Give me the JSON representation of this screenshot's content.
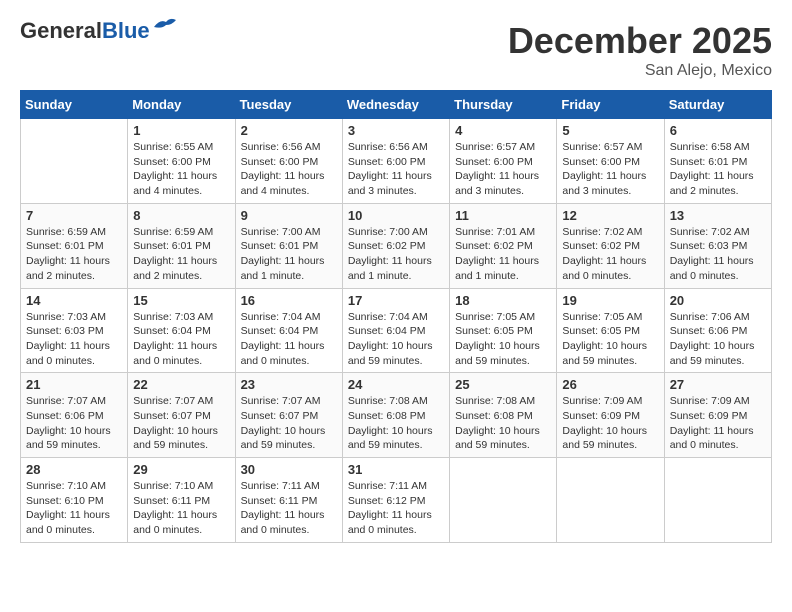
{
  "header": {
    "logo_general": "General",
    "logo_blue": "Blue",
    "month": "December 2025",
    "location": "San Alejo, Mexico"
  },
  "weekdays": [
    "Sunday",
    "Monday",
    "Tuesday",
    "Wednesday",
    "Thursday",
    "Friday",
    "Saturday"
  ],
  "weeks": [
    [
      {
        "day": "",
        "sunrise": "",
        "sunset": "",
        "daylight": ""
      },
      {
        "day": "1",
        "sunrise": "Sunrise: 6:55 AM",
        "sunset": "Sunset: 6:00 PM",
        "daylight": "Daylight: 11 hours and 4 minutes."
      },
      {
        "day": "2",
        "sunrise": "Sunrise: 6:56 AM",
        "sunset": "Sunset: 6:00 PM",
        "daylight": "Daylight: 11 hours and 4 minutes."
      },
      {
        "day": "3",
        "sunrise": "Sunrise: 6:56 AM",
        "sunset": "Sunset: 6:00 PM",
        "daylight": "Daylight: 11 hours and 3 minutes."
      },
      {
        "day": "4",
        "sunrise": "Sunrise: 6:57 AM",
        "sunset": "Sunset: 6:00 PM",
        "daylight": "Daylight: 11 hours and 3 minutes."
      },
      {
        "day": "5",
        "sunrise": "Sunrise: 6:57 AM",
        "sunset": "Sunset: 6:00 PM",
        "daylight": "Daylight: 11 hours and 3 minutes."
      },
      {
        "day": "6",
        "sunrise": "Sunrise: 6:58 AM",
        "sunset": "Sunset: 6:01 PM",
        "daylight": "Daylight: 11 hours and 2 minutes."
      }
    ],
    [
      {
        "day": "7",
        "sunrise": "Sunrise: 6:59 AM",
        "sunset": "Sunset: 6:01 PM",
        "daylight": "Daylight: 11 hours and 2 minutes."
      },
      {
        "day": "8",
        "sunrise": "Sunrise: 6:59 AM",
        "sunset": "Sunset: 6:01 PM",
        "daylight": "Daylight: 11 hours and 2 minutes."
      },
      {
        "day": "9",
        "sunrise": "Sunrise: 7:00 AM",
        "sunset": "Sunset: 6:01 PM",
        "daylight": "Daylight: 11 hours and 1 minute."
      },
      {
        "day": "10",
        "sunrise": "Sunrise: 7:00 AM",
        "sunset": "Sunset: 6:02 PM",
        "daylight": "Daylight: 11 hours and 1 minute."
      },
      {
        "day": "11",
        "sunrise": "Sunrise: 7:01 AM",
        "sunset": "Sunset: 6:02 PM",
        "daylight": "Daylight: 11 hours and 1 minute."
      },
      {
        "day": "12",
        "sunrise": "Sunrise: 7:02 AM",
        "sunset": "Sunset: 6:02 PM",
        "daylight": "Daylight: 11 hours and 0 minutes."
      },
      {
        "day": "13",
        "sunrise": "Sunrise: 7:02 AM",
        "sunset": "Sunset: 6:03 PM",
        "daylight": "Daylight: 11 hours and 0 minutes."
      }
    ],
    [
      {
        "day": "14",
        "sunrise": "Sunrise: 7:03 AM",
        "sunset": "Sunset: 6:03 PM",
        "daylight": "Daylight: 11 hours and 0 minutes."
      },
      {
        "day": "15",
        "sunrise": "Sunrise: 7:03 AM",
        "sunset": "Sunset: 6:04 PM",
        "daylight": "Daylight: 11 hours and 0 minutes."
      },
      {
        "day": "16",
        "sunrise": "Sunrise: 7:04 AM",
        "sunset": "Sunset: 6:04 PM",
        "daylight": "Daylight: 11 hours and 0 minutes."
      },
      {
        "day": "17",
        "sunrise": "Sunrise: 7:04 AM",
        "sunset": "Sunset: 6:04 PM",
        "daylight": "Daylight: 10 hours and 59 minutes."
      },
      {
        "day": "18",
        "sunrise": "Sunrise: 7:05 AM",
        "sunset": "Sunset: 6:05 PM",
        "daylight": "Daylight: 10 hours and 59 minutes."
      },
      {
        "day": "19",
        "sunrise": "Sunrise: 7:05 AM",
        "sunset": "Sunset: 6:05 PM",
        "daylight": "Daylight: 10 hours and 59 minutes."
      },
      {
        "day": "20",
        "sunrise": "Sunrise: 7:06 AM",
        "sunset": "Sunset: 6:06 PM",
        "daylight": "Daylight: 10 hours and 59 minutes."
      }
    ],
    [
      {
        "day": "21",
        "sunrise": "Sunrise: 7:07 AM",
        "sunset": "Sunset: 6:06 PM",
        "daylight": "Daylight: 10 hours and 59 minutes."
      },
      {
        "day": "22",
        "sunrise": "Sunrise: 7:07 AM",
        "sunset": "Sunset: 6:07 PM",
        "daylight": "Daylight: 10 hours and 59 minutes."
      },
      {
        "day": "23",
        "sunrise": "Sunrise: 7:07 AM",
        "sunset": "Sunset: 6:07 PM",
        "daylight": "Daylight: 10 hours and 59 minutes."
      },
      {
        "day": "24",
        "sunrise": "Sunrise: 7:08 AM",
        "sunset": "Sunset: 6:08 PM",
        "daylight": "Daylight: 10 hours and 59 minutes."
      },
      {
        "day": "25",
        "sunrise": "Sunrise: 7:08 AM",
        "sunset": "Sunset: 6:08 PM",
        "daylight": "Daylight: 10 hours and 59 minutes."
      },
      {
        "day": "26",
        "sunrise": "Sunrise: 7:09 AM",
        "sunset": "Sunset: 6:09 PM",
        "daylight": "Daylight: 10 hours and 59 minutes."
      },
      {
        "day": "27",
        "sunrise": "Sunrise: 7:09 AM",
        "sunset": "Sunset: 6:09 PM",
        "daylight": "Daylight: 11 hours and 0 minutes."
      }
    ],
    [
      {
        "day": "28",
        "sunrise": "Sunrise: 7:10 AM",
        "sunset": "Sunset: 6:10 PM",
        "daylight": "Daylight: 11 hours and 0 minutes."
      },
      {
        "day": "29",
        "sunrise": "Sunrise: 7:10 AM",
        "sunset": "Sunset: 6:11 PM",
        "daylight": "Daylight: 11 hours and 0 minutes."
      },
      {
        "day": "30",
        "sunrise": "Sunrise: 7:11 AM",
        "sunset": "Sunset: 6:11 PM",
        "daylight": "Daylight: 11 hours and 0 minutes."
      },
      {
        "day": "31",
        "sunrise": "Sunrise: 7:11 AM",
        "sunset": "Sunset: 6:12 PM",
        "daylight": "Daylight: 11 hours and 0 minutes."
      },
      {
        "day": "",
        "sunrise": "",
        "sunset": "",
        "daylight": ""
      },
      {
        "day": "",
        "sunrise": "",
        "sunset": "",
        "daylight": ""
      },
      {
        "day": "",
        "sunrise": "",
        "sunset": "",
        "daylight": ""
      }
    ]
  ]
}
